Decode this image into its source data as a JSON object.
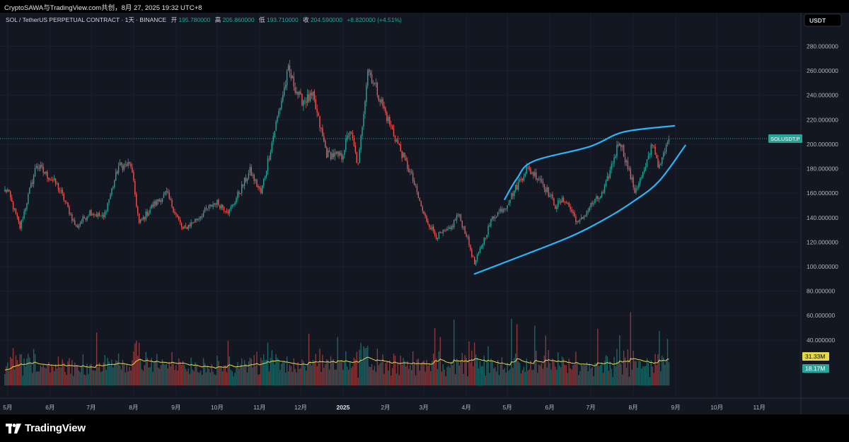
{
  "header": {
    "share_text": "CryptoSAWA与TradingView.com共创，8月 27, 2025 19:32 UTC+8"
  },
  "chart_data": {
    "type": "candlestick",
    "symbol_line": {
      "name": "SOL / TetherUS PERPETUAL CONTRACT · 1天 · BINANCE",
      "open_label": "开",
      "open": "195.780000",
      "high_label": "高",
      "high": "205.860000",
      "low_label": "低",
      "low": "193.710000",
      "close_label": "收",
      "close": "204.590000",
      "change": "+8.820000 (+4.51%)"
    },
    "currency": "USDT",
    "y_ticks": [
      "280.000000",
      "260.000000",
      "240.000000",
      "220.000000",
      "200.000000",
      "180.000000",
      "160.000000",
      "140.000000",
      "120.000000",
      "100.000000",
      "80.000000",
      "60.000000",
      "40.000000"
    ],
    "y_tick_values": [
      280,
      260,
      240,
      220,
      200,
      180,
      160,
      140,
      120,
      100,
      80,
      60,
      40
    ],
    "x_labels": [
      "5月",
      "6月",
      "7月",
      "8月",
      "9月",
      "10月",
      "11月",
      "12月",
      "2025",
      "2月",
      "3月",
      "4月",
      "5月",
      "6月",
      "7月",
      "8月",
      "9月",
      "10月",
      "11月"
    ],
    "price_path": [
      [
        "2024-05-01",
        162
      ],
      [
        "2024-05-10",
        132
      ],
      [
        "2024-05-22",
        183
      ],
      [
        "2024-06-05",
        168
      ],
      [
        "2024-06-10",
        158
      ],
      [
        "2024-06-20",
        132
      ],
      [
        "2024-06-30",
        145
      ],
      [
        "2024-07-10",
        140
      ],
      [
        "2024-07-21",
        182
      ],
      [
        "2024-07-30",
        183
      ],
      [
        "2024-08-05",
        135
      ],
      [
        "2024-08-15",
        150
      ],
      [
        "2024-08-25",
        160
      ],
      [
        "2024-09-06",
        130
      ],
      [
        "2024-09-15",
        138
      ],
      [
        "2024-09-30",
        153
      ],
      [
        "2024-10-10",
        145
      ],
      [
        "2024-10-25",
        178
      ],
      [
        "2024-11-02",
        160
      ],
      [
        "2024-11-12",
        212
      ],
      [
        "2024-11-22",
        260
      ],
      [
        "2024-12-01",
        236
      ],
      [
        "2024-12-10",
        238
      ],
      [
        "2024-12-20",
        192
      ],
      [
        "2024-12-31",
        190
      ],
      [
        "2025-01-06",
        212
      ],
      [
        "2025-01-12",
        182
      ],
      [
        "2025-01-19",
        262
      ],
      [
        "2025-01-25",
        246
      ],
      [
        "2025-02-01",
        225
      ],
      [
        "2025-02-10",
        200
      ],
      [
        "2025-02-20",
        174
      ],
      [
        "2025-03-01",
        142
      ],
      [
        "2025-03-10",
        125
      ],
      [
        "2025-03-20",
        130
      ],
      [
        "2025-03-26",
        143
      ],
      [
        "2025-04-01",
        126
      ],
      [
        "2025-04-07",
        102
      ],
      [
        "2025-04-20",
        140
      ],
      [
        "2025-04-30",
        150
      ],
      [
        "2025-05-15",
        180
      ],
      [
        "2025-05-25",
        172
      ],
      [
        "2025-06-05",
        150
      ],
      [
        "2025-06-12",
        155
      ],
      [
        "2025-06-22",
        135
      ],
      [
        "2025-07-01",
        150
      ],
      [
        "2025-07-10",
        160
      ],
      [
        "2025-07-22",
        204
      ],
      [
        "2025-08-02",
        162
      ],
      [
        "2025-08-10",
        180
      ],
      [
        "2025-08-15",
        202
      ],
      [
        "2025-08-20",
        180
      ],
      [
        "2025-08-27",
        204.59
      ]
    ],
    "channel_upper": [
      [
        "2025-04-29",
        155
      ],
      [
        "2025-05-08",
        172
      ],
      [
        "2025-05-20",
        186
      ],
      [
        "2025-06-30",
        198
      ],
      [
        "2025-07-25",
        210
      ],
      [
        "2025-08-31",
        215
      ]
    ],
    "channel_lower": [
      [
        "2025-04-07",
        94
      ],
      [
        "2025-05-05",
        106
      ],
      [
        "2025-06-15",
        124
      ],
      [
        "2025-07-10",
        138
      ],
      [
        "2025-08-02",
        154
      ],
      [
        "2025-08-20",
        170
      ],
      [
        "2025-09-08",
        199
      ]
    ],
    "price_tag": "SOLUSDT.P",
    "last_price": 204.59,
    "volume_ma_label": "31.33M",
    "volume_label": "18.17M",
    "colors": {
      "up": "#26a69a",
      "down": "#ef5350",
      "channel": "#29b6f6",
      "volume_ma": "#e5d84a",
      "background": "#131722",
      "grid": "#1c2030"
    }
  },
  "footer": {
    "brand": "TradingView"
  }
}
